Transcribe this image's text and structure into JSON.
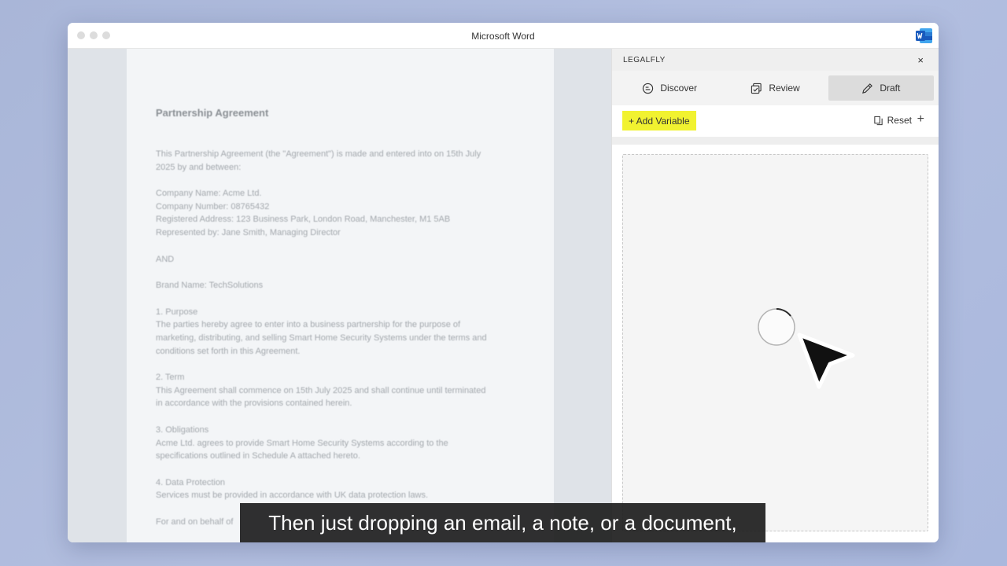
{
  "window": {
    "title": "Microsoft Word",
    "app_icon": "word-icon"
  },
  "document": {
    "title": "Partnership Agreement",
    "blocks": [
      [
        "This Partnership Agreement (the \"Agreement\") is made and entered into on 15th July",
        "2025 by and between:"
      ],
      [
        "Company Name: Acme Ltd.",
        "Company Number: 08765432",
        "Registered Address: 123 Business Park, London Road, Manchester, M1 5AB",
        "Represented by: Jane Smith, Managing Director"
      ],
      [
        "AND"
      ],
      [
        "Brand Name: TechSolutions"
      ],
      [
        "1. Purpose",
        "The parties hereby agree to enter into a business partnership for the purpose of",
        "marketing, distributing, and selling Smart Home Security Systems under the terms and",
        "conditions set forth in this Agreement."
      ],
      [
        "2. Term",
        "This Agreement shall commence on 15th July 2025 and shall continue until terminated",
        "in accordance with the provisions contained herein."
      ],
      [
        "3. Obligations",
        "Acme Ltd. agrees to provide Smart Home Security Systems according to the",
        "specifications outlined in Schedule A attached hereto."
      ],
      [
        "4. Data Protection",
        "Services must be provided in accordance with UK data protection laws."
      ],
      [
        "For and on behalf of"
      ]
    ]
  },
  "panel": {
    "brand": "LEGALFLY",
    "close_label": "×",
    "tabs": [
      {
        "label": "Discover",
        "icon": "discover-icon",
        "active": false
      },
      {
        "label": "Review",
        "icon": "review-icon",
        "active": false
      },
      {
        "label": "Draft",
        "icon": "pencil-icon",
        "active": true
      }
    ],
    "add_variable_label": "+ Add Variable",
    "reset_label": "Reset",
    "plus_label": "+"
  },
  "caption": {
    "text": "Then just dropping an email, a note, or a document,"
  },
  "colors": {
    "highlight": "#f1f230",
    "caption_bg": "#191919"
  }
}
